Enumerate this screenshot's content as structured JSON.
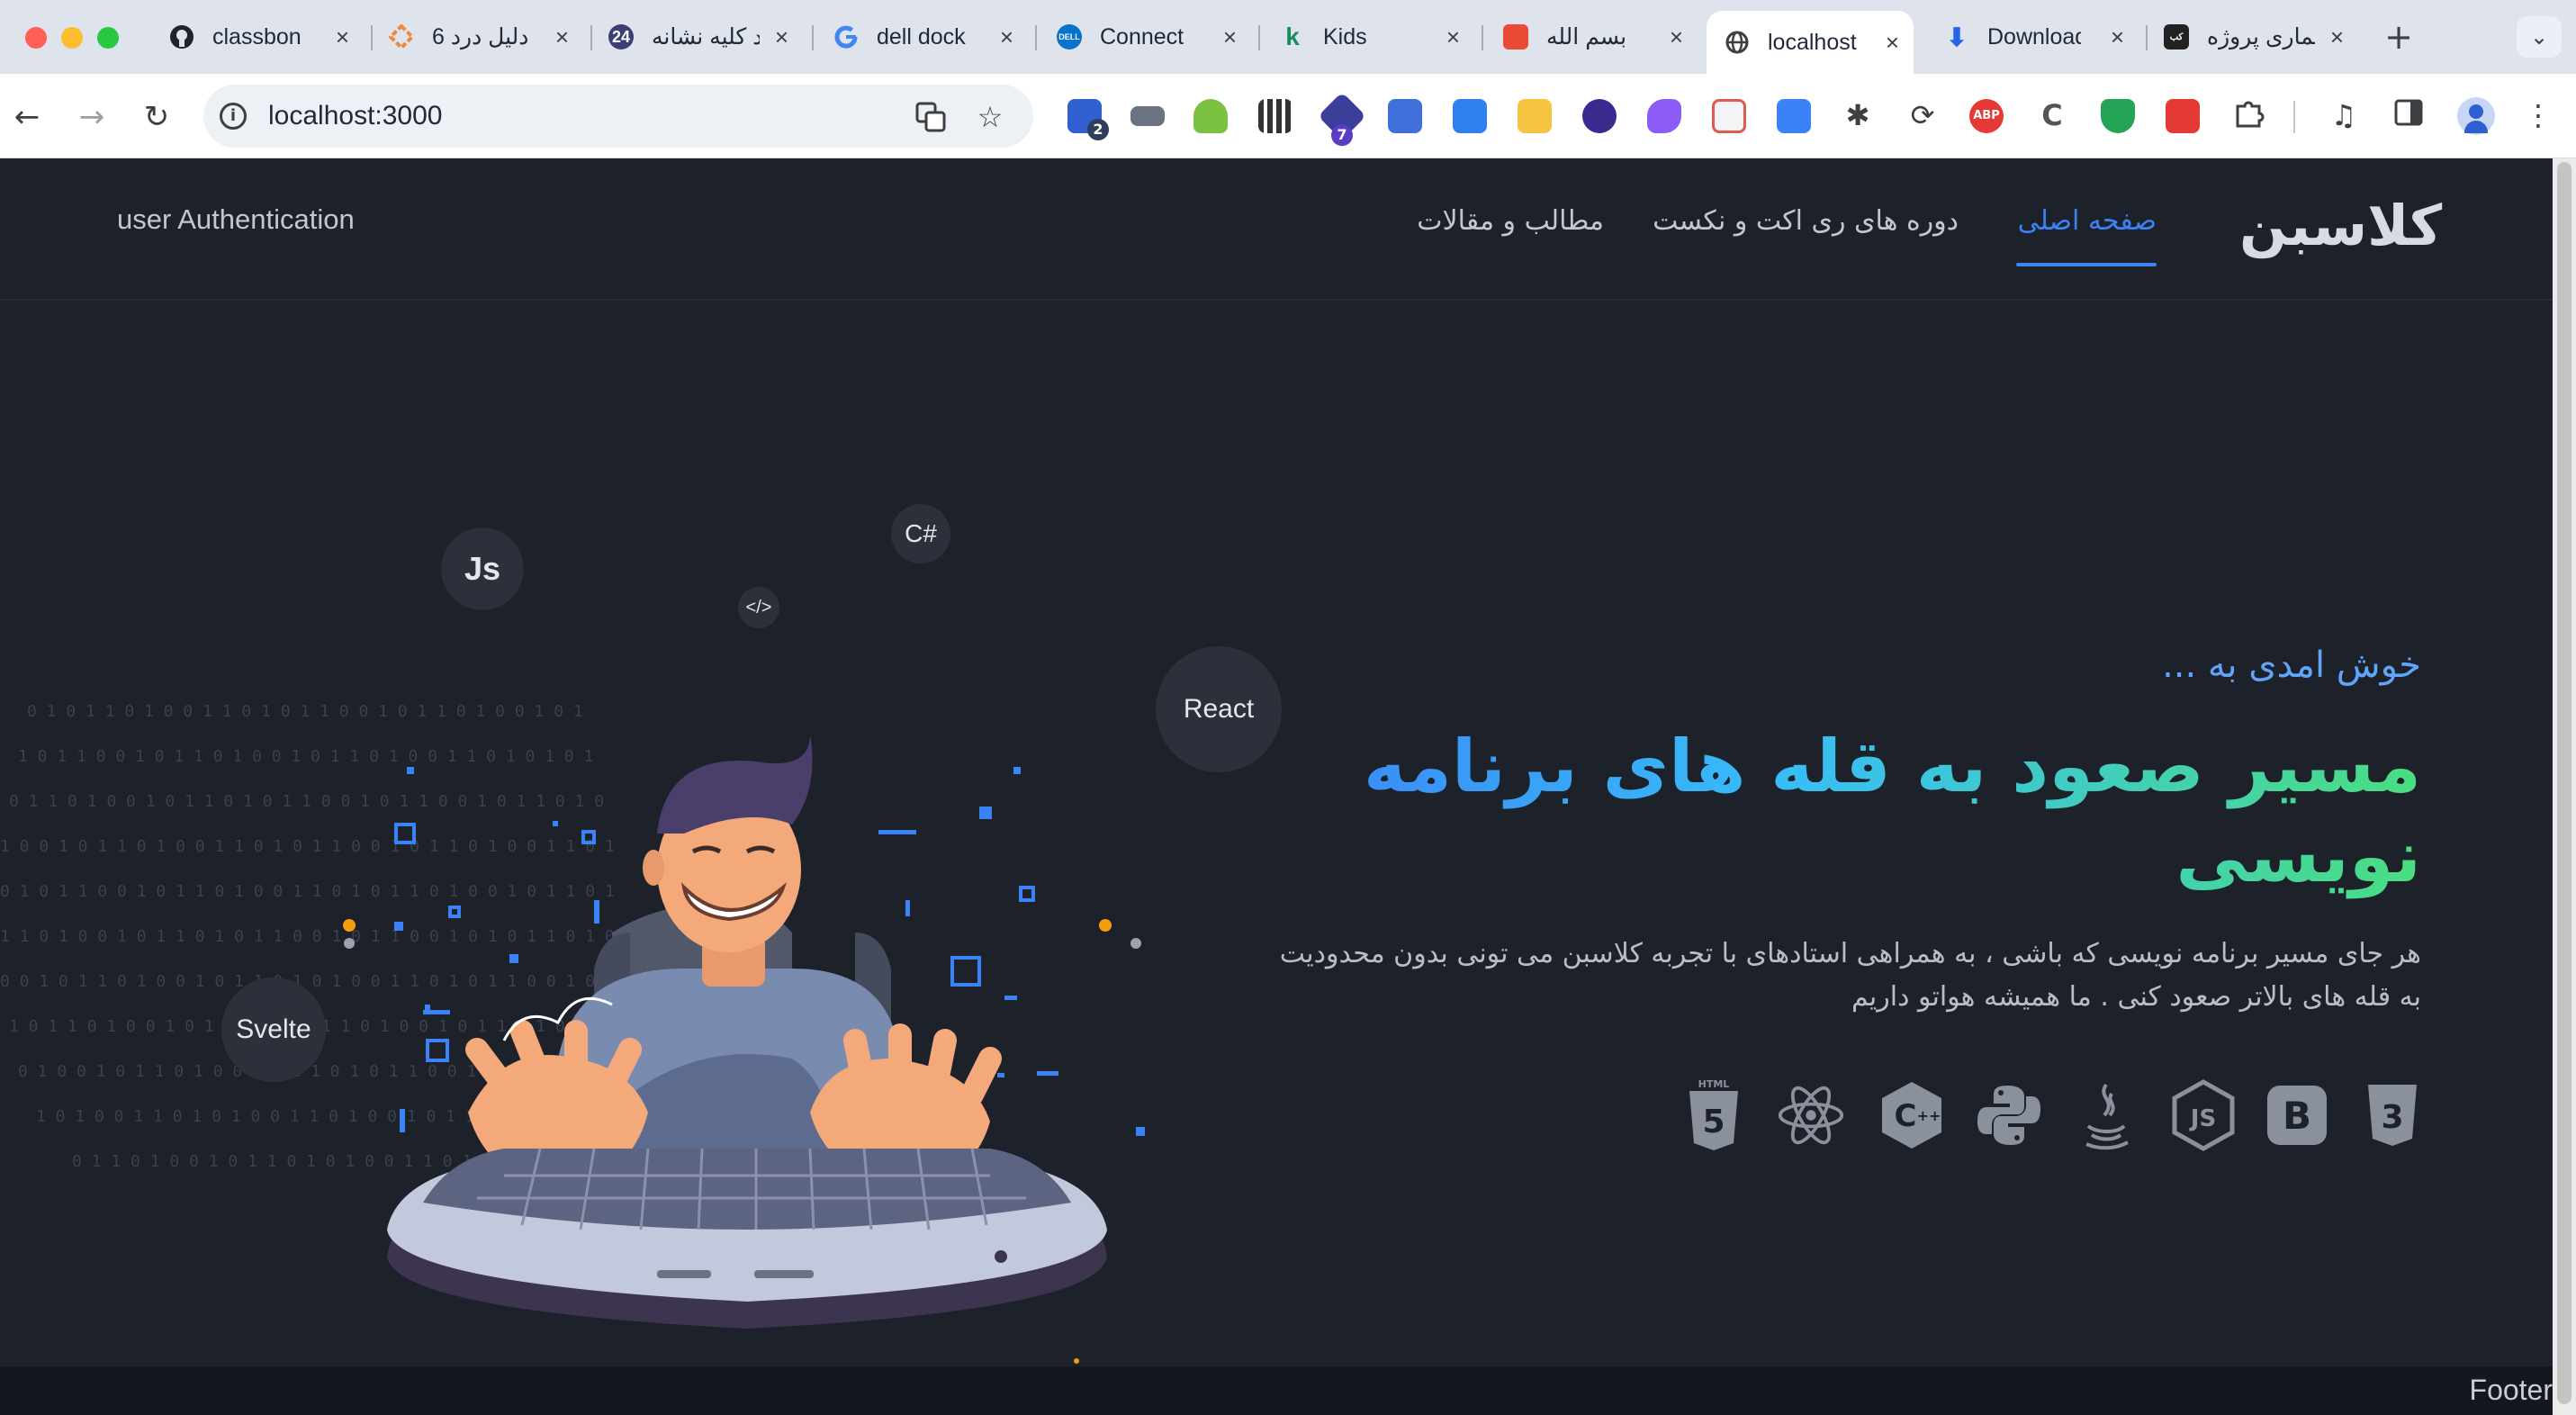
{
  "browser": {
    "tabs": [
      {
        "label": "classbon",
        "favicon": "github-icon"
      },
      {
        "label": "6 دلیل درد",
        "favicon": "diamond-icon"
      },
      {
        "label": "درد کلیه نشانه",
        "favicon": "doctor-icon"
      },
      {
        "label": "dell dock",
        "favicon": "google-icon"
      },
      {
        "label": "Connect",
        "favicon": "dell-icon"
      },
      {
        "label": "Kids",
        "favicon": "k-icon"
      },
      {
        "label": "بسم الله",
        "favicon": "red-square-icon"
      },
      {
        "label": "localhost",
        "favicon": "globe-icon",
        "active": true
      },
      {
        "label": "Download",
        "favicon": "download-icon"
      },
      {
        "label": "معماری پروژه",
        "favicon": "site-icon"
      }
    ],
    "url": "localhost:3000",
    "extension_badges": {
      "first": "2",
      "second": "7"
    }
  },
  "site": {
    "brand": "کلاسبن",
    "nav": {
      "home": "صفحه اصلی",
      "courses": "دوره های ری اکت و نکست",
      "articles": "مطالب و مقالات"
    },
    "auth": "user Authentication",
    "hero": {
      "welcome": "خوش امدی به ...",
      "headline": "مسیر صعود به قله های برنامه نویسی",
      "description": "هر جای مسیر برنامه نویسی که باشی ، به همراهی استادهای با تجربه کلاسبن می تونی بدون محدودیت به قله های بالاتر صعود کنی . ما همیشه هواتو داریم"
    },
    "tech_icons": [
      "css3-icon",
      "bootstrap-icon",
      "nodejs-icon",
      "java-icon",
      "python-icon",
      "cplusplus-icon",
      "react-icon",
      "html5-icon"
    ],
    "bubbles": {
      "js": "Js",
      "csharp": "C#",
      "code": "</>",
      "react": "React",
      "svelte": "Svelte"
    },
    "footer": "Footer"
  },
  "colors": {
    "accent": "#3b82f6",
    "gradient_end": "#4ade80",
    "background": "#1d2129"
  }
}
